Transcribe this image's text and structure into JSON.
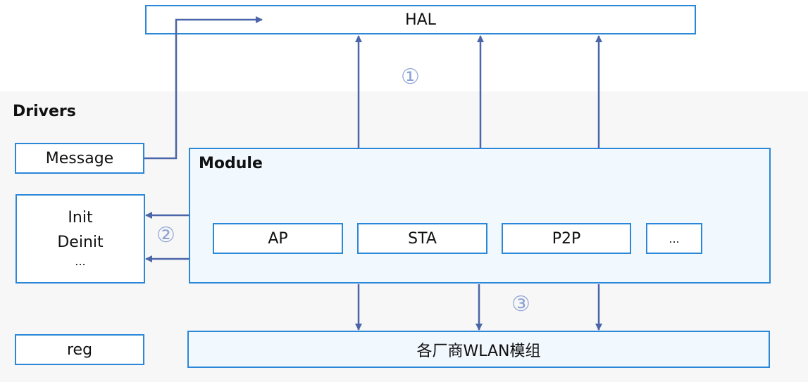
{
  "hal": {
    "label": "HAL"
  },
  "drivers": {
    "title": "Drivers"
  },
  "message": {
    "label": "Message"
  },
  "lifecycle": {
    "lines": [
      "Init",
      "Deinit",
      "..."
    ]
  },
  "reg": {
    "label": "reg"
  },
  "module": {
    "title": "Module",
    "items": [
      "AP",
      "STA",
      "P2P",
      "..."
    ]
  },
  "vendor": {
    "label": "各厂商WLAN模组"
  },
  "markers": [
    "①",
    "②",
    "③"
  ],
  "colors": {
    "border": "#2b88d8",
    "arrow": "#4a65a8",
    "marker": "#8fa3d6",
    "module_fill": "#f1f8fe",
    "drivers_fill": "#f7f7f7"
  }
}
